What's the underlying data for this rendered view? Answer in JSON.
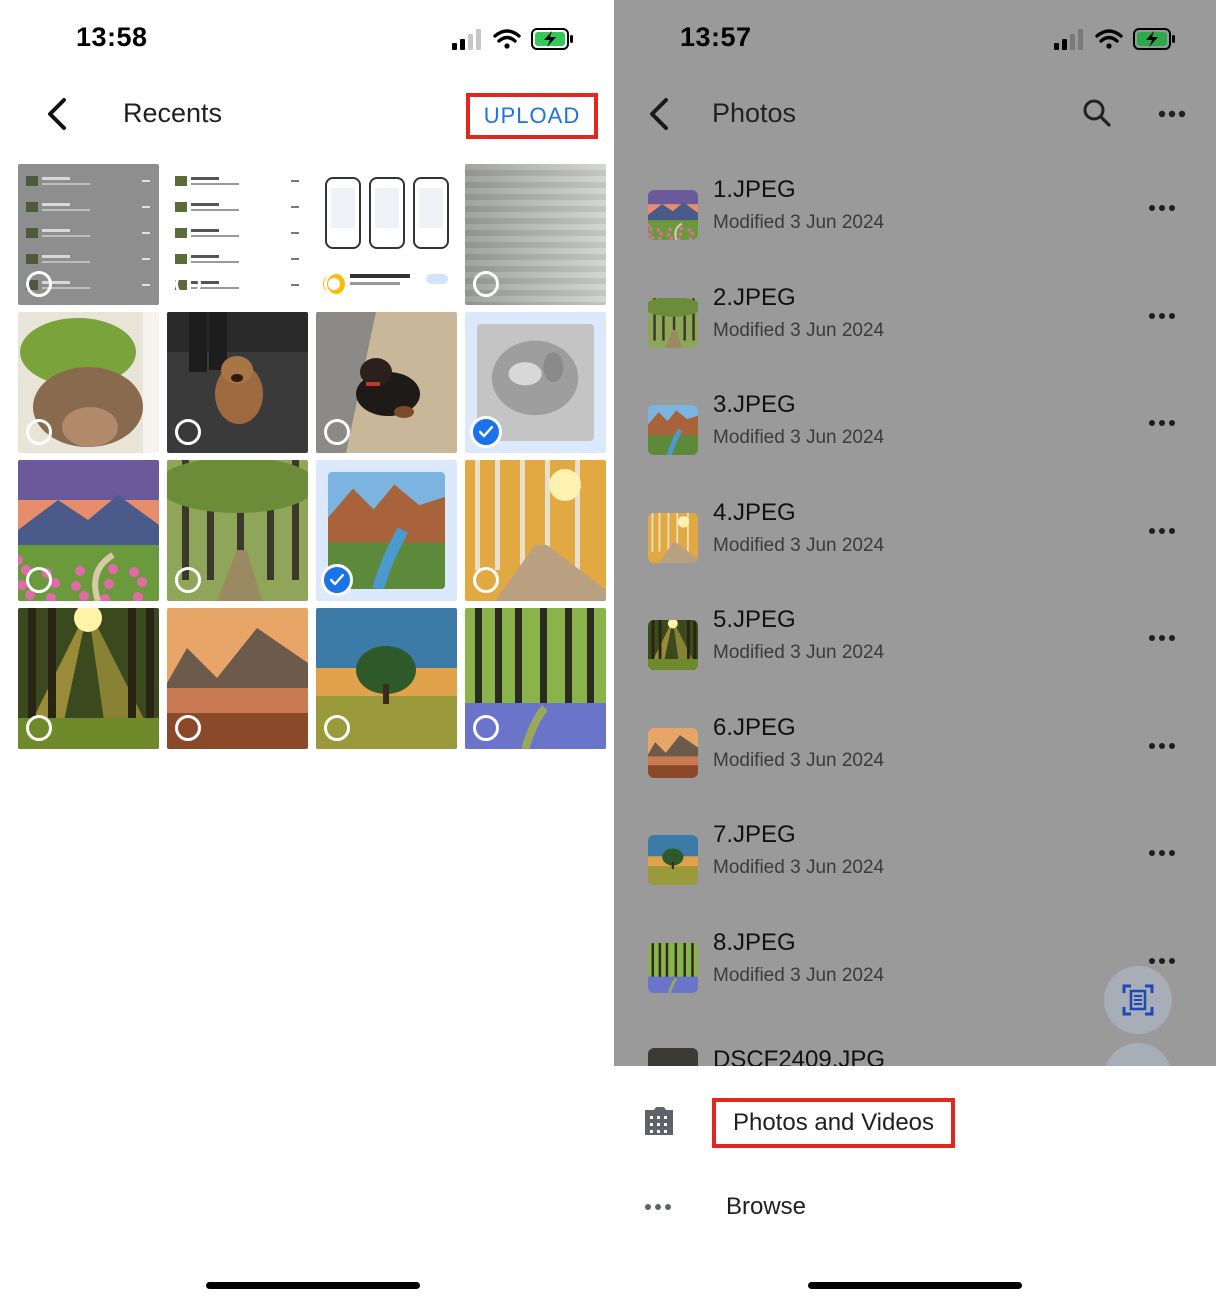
{
  "left": {
    "status_time": "13:58",
    "title": "Recents",
    "upload_label": "UPLOAD",
    "grid": [
      {
        "kind": "screenshot-list",
        "selected": false
      },
      {
        "kind": "screenshot-list-white",
        "selected": false
      },
      {
        "kind": "screenshot-phones",
        "selected": false
      },
      {
        "kind": "blinds",
        "selected": false
      },
      {
        "kind": "cat-bed",
        "selected": false
      },
      {
        "kind": "dog-carpet",
        "selected": false
      },
      {
        "kind": "dog-floor",
        "selected": false
      },
      {
        "kind": "cat-closeup",
        "selected": true
      },
      {
        "kind": "mountain-flowers",
        "selected": false
      },
      {
        "kind": "forest-path",
        "selected": false
      },
      {
        "kind": "canyon-river",
        "selected": true
      },
      {
        "kind": "autumn-road",
        "selected": false
      },
      {
        "kind": "sunbeam-forest",
        "selected": false
      },
      {
        "kind": "mountain-lake",
        "selected": false
      },
      {
        "kind": "lone-tree",
        "selected": false
      },
      {
        "kind": "bluebell-forest",
        "selected": false
      }
    ]
  },
  "right": {
    "status_time": "13:57",
    "title": "Photos",
    "files": [
      {
        "name": "1.JPEG",
        "modified": "Modified 3 Jun 2024",
        "thumb": "mountain-flowers"
      },
      {
        "name": "2.JPEG",
        "modified": "Modified 3 Jun 2024",
        "thumb": "forest-path"
      },
      {
        "name": "3.JPEG",
        "modified": "Modified 3 Jun 2024",
        "thumb": "canyon-river"
      },
      {
        "name": "4.JPEG",
        "modified": "Modified 3 Jun 2024",
        "thumb": "autumn-road"
      },
      {
        "name": "5.JPEG",
        "modified": "Modified 3 Jun 2024",
        "thumb": "sunbeam-forest"
      },
      {
        "name": "6.JPEG",
        "modified": "Modified 3 Jun 2024",
        "thumb": "mountain-lake"
      },
      {
        "name": "7.JPEG",
        "modified": "Modified 3 Jun 2024",
        "thumb": "lone-tree"
      },
      {
        "name": "8.JPEG",
        "modified": "Modified 3 Jun 2024",
        "thumb": "bluebell-forest"
      }
    ],
    "partial_file": "DSCF2409.JPG",
    "sheet": {
      "photos_videos_label": "Photos and Videos",
      "browse_label": "Browse"
    }
  },
  "colors": {
    "accent": "#1a73e8",
    "highlight_box": "#e3261e",
    "overlay_gray": "#9a9a9a"
  },
  "icons": [
    "back-chevron-icon",
    "signal-icon",
    "wifi-icon",
    "battery-charging-icon",
    "search-icon",
    "more-icon",
    "scan-icon",
    "photos-folder-icon",
    "more-dots-icon"
  ]
}
